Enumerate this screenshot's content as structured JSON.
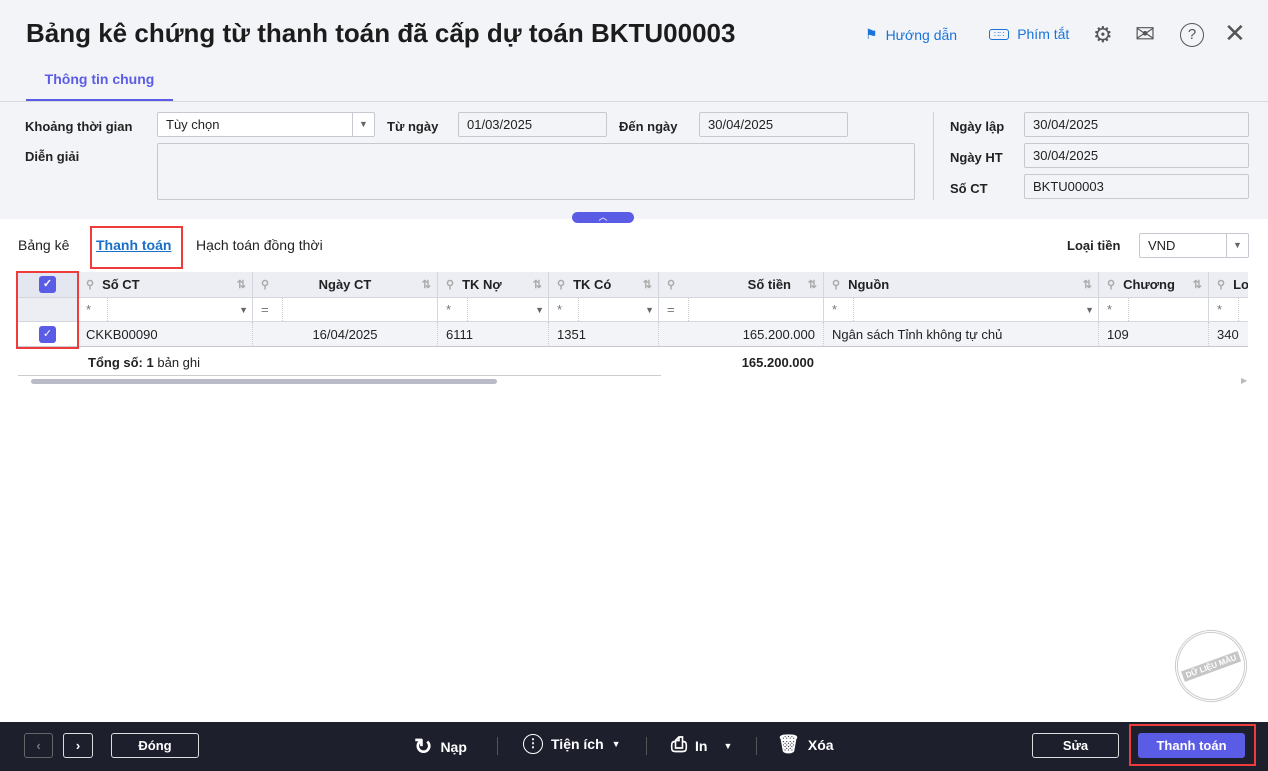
{
  "header": {
    "title": "Bảng kê chứng từ thanh toán đã cấp dự toán BKTU00003",
    "guide": "Hướng dẫn",
    "shortcuts": "Phím tắt"
  },
  "tabs": {
    "general": "Thông tin chung"
  },
  "form": {
    "period_label": "Khoảng thời gian",
    "period_value": "Tùy chọn",
    "from_label": "Từ ngày",
    "from_value": "01/03/2025",
    "to_label": "Đến ngày",
    "to_value": "30/04/2025",
    "desc_label": "Diễn giải",
    "desc_value": "",
    "created_label": "Ngày lập",
    "created_value": "30/04/2025",
    "posted_label": "Ngày HT",
    "posted_value": "30/04/2025",
    "docno_label": "Số CT",
    "docno_value": "BKTU00003"
  },
  "subtabs": [
    "Bảng kê",
    "Thanh toán",
    "Hạch toán đồng thời"
  ],
  "currency": {
    "label": "Loại tiền",
    "value": "VND"
  },
  "grid": {
    "columns": [
      "Số CT",
      "Ngày CT",
      "TK Nợ",
      "TK Có",
      "Số tiền",
      "Nguồn",
      "Chương",
      "Lo"
    ],
    "filters": [
      "*",
      "=",
      "*",
      "*",
      "=",
      "*",
      "*",
      "*"
    ],
    "rows": [
      {
        "so_ct": "CKKB00090",
        "ngay_ct": "16/04/2025",
        "tk_no": "6111",
        "tk_co": "1351",
        "so_tien": "165.200.000",
        "nguon": "Ngân sách Tỉnh không tự chủ",
        "chuong": "109",
        "lo": "340"
      }
    ],
    "total_prefix": "Tổng số:",
    "total_count": "1",
    "total_suffix": "bản ghi",
    "total_amount": "165.200.000"
  },
  "watermark": "DỮ LIỆU MẪU",
  "footer": {
    "close": "Đóng",
    "reload": "Nạp",
    "utilities": "Tiện ích",
    "print": "In",
    "delete": "Xóa",
    "edit": "Sửa",
    "pay": "Thanh toán"
  }
}
